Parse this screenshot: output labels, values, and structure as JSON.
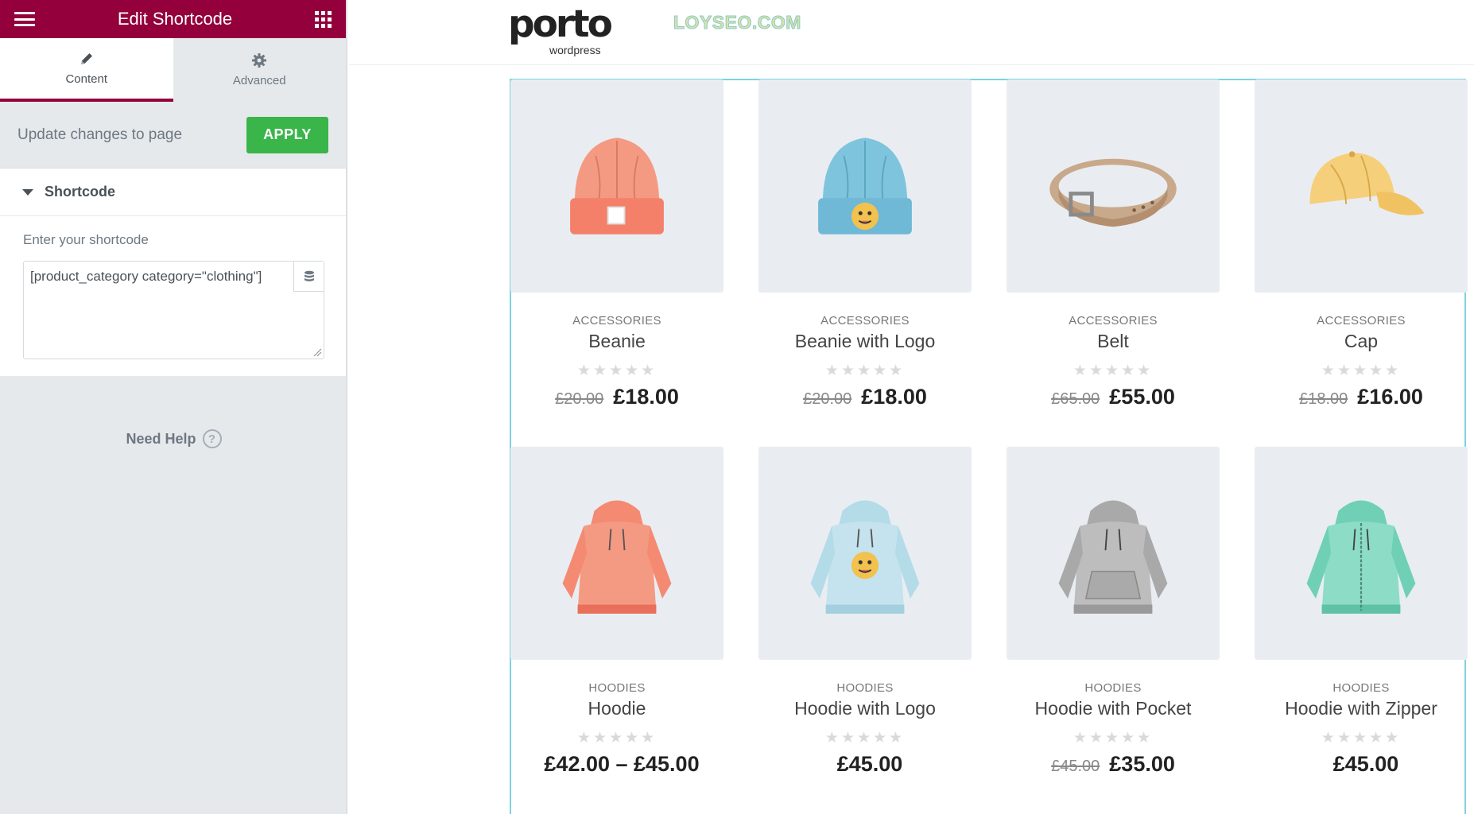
{
  "panel": {
    "title": "Edit Shortcode",
    "tabs": [
      {
        "label": "Content",
        "icon": "pencil-icon",
        "active": true
      },
      {
        "label": "Advanced",
        "icon": "gear-icon",
        "active": false
      }
    ],
    "apply_text": "Update changes to page",
    "apply_button": "APPLY",
    "section_title": "Shortcode",
    "field_label": "Enter your shortcode",
    "shortcode_value": "[product_category category=\"clothing\"]",
    "help_text": "Need Help",
    "accent_color": "#93003c",
    "apply_color": "#39b54a"
  },
  "site": {
    "logo_text": "porto",
    "logo_sub": "wordpress",
    "watermark": "LOYSEO.COM"
  },
  "products": [
    {
      "category": "ACCESSORIES",
      "name": "Beanie",
      "old_price": "£20.00",
      "price": "£18.00",
      "stars": "★★★★★",
      "image": "orange-beanie"
    },
    {
      "category": "ACCESSORIES",
      "name": "Beanie with Logo",
      "old_price": "£20.00",
      "price": "£18.00",
      "stars": "★★★★★",
      "image": "blue-beanie-logo"
    },
    {
      "category": "ACCESSORIES",
      "name": "Belt",
      "old_price": "£65.00",
      "price": "£55.00",
      "stars": "★★★★★",
      "image": "belt"
    },
    {
      "category": "ACCESSORIES",
      "name": "Cap",
      "old_price": "£18.00",
      "price": "£16.00",
      "stars": "★★★★★",
      "image": "cap"
    },
    {
      "category": "HOODIES",
      "name": "Hoodie",
      "old_price": "",
      "price": "£42.00 – £45.00",
      "stars": "★★★★★",
      "image": "orange-hoodie"
    },
    {
      "category": "HOODIES",
      "name": "Hoodie with Logo",
      "old_price": "",
      "price": "£45.00",
      "stars": "★★★★★",
      "image": "blue-hoodie-logo"
    },
    {
      "category": "HOODIES",
      "name": "Hoodie with Pocket",
      "old_price": "£45.00",
      "price": "£35.00",
      "stars": "★★★★★",
      "image": "grey-hoodie"
    },
    {
      "category": "HOODIES",
      "name": "Hoodie with Zipper",
      "old_price": "",
      "price": "£45.00",
      "stars": "★★★★★",
      "image": "green-hoodie-zipper"
    }
  ]
}
